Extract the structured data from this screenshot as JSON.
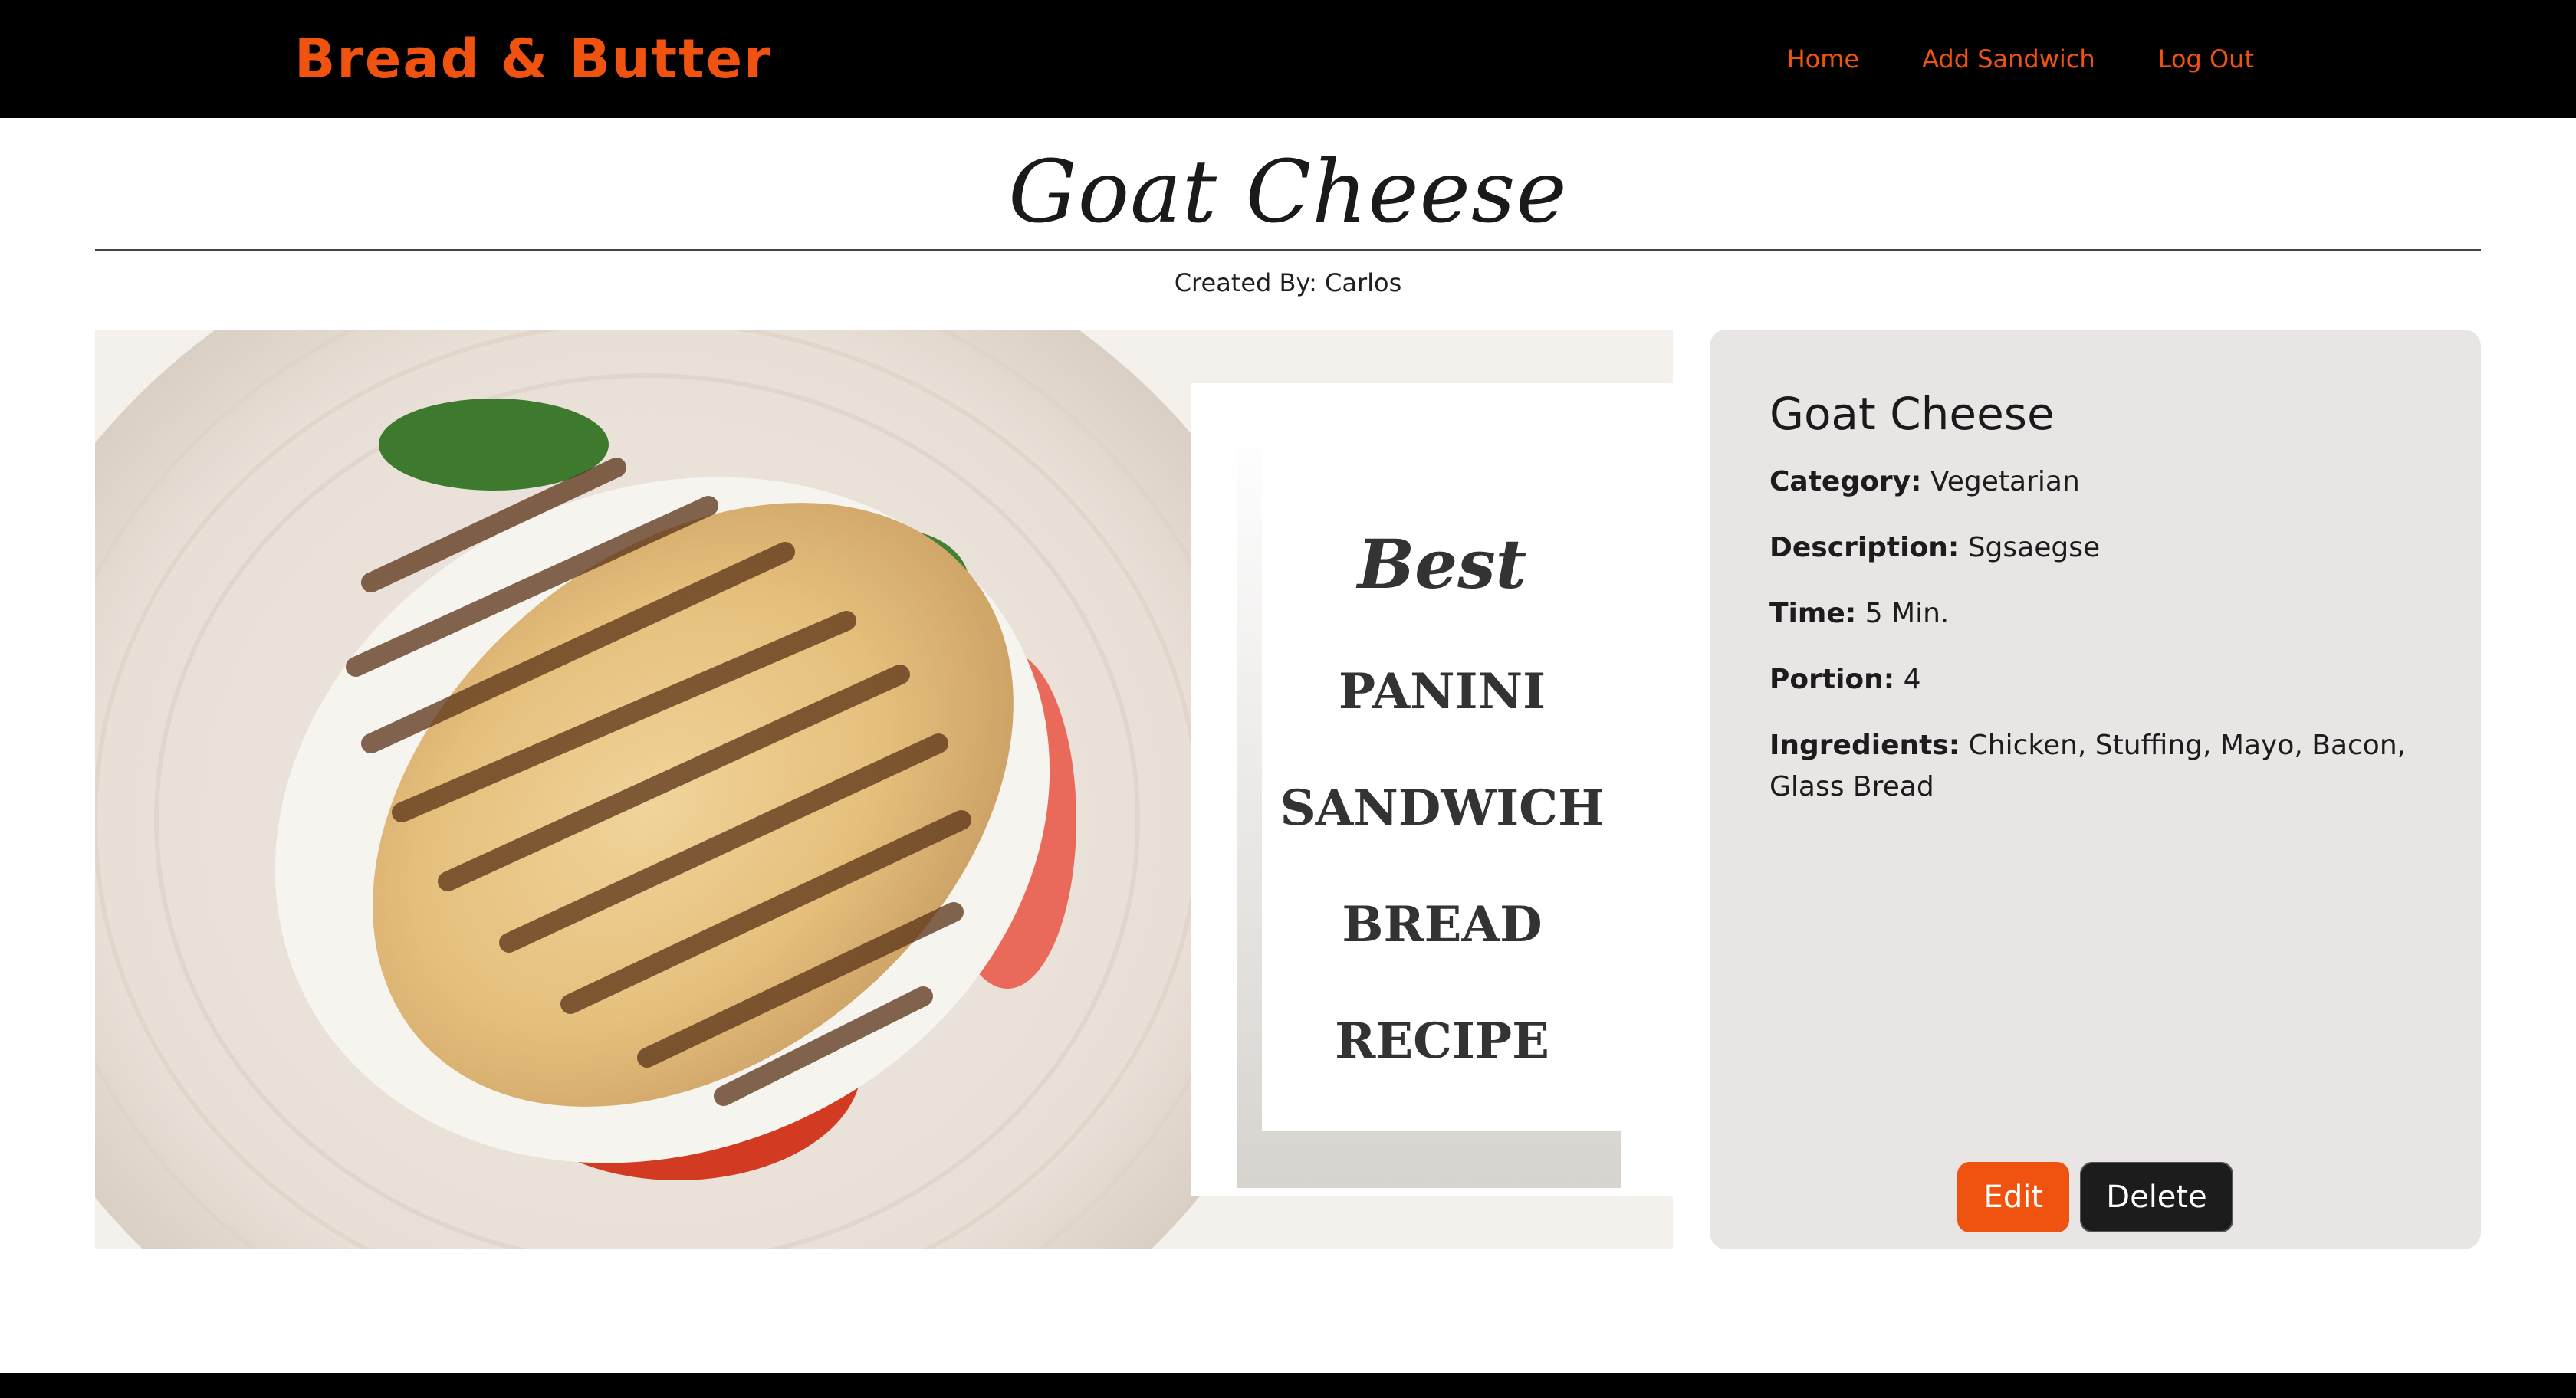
{
  "nav": {
    "brand": "Bread & Butter",
    "links": [
      "Home",
      "Add Sandwich",
      "Log Out"
    ]
  },
  "page": {
    "title": "Goat Cheese",
    "created_by": "Created By: Carlos"
  },
  "image": {
    "overlay_lines": [
      "Best",
      "PANINI",
      "SANDWICH",
      "BREAD",
      "RECIPE"
    ]
  },
  "details": {
    "name": "Goat Cheese",
    "fields": [
      {
        "label": "Category:",
        "value": "Vegetarian"
      },
      {
        "label": "Description:",
        "value": "Sgsaegse"
      },
      {
        "label": "Time:",
        "value": "5 Min."
      },
      {
        "label": "Portion:",
        "value": "4"
      },
      {
        "label": "Ingredients:",
        "value": "Chicken, Stuffing, Mayo, Bacon, Glass Bread"
      }
    ]
  },
  "actions": {
    "edit": "Edit",
    "delete": "Delete"
  },
  "colors": {
    "accent": "#f0520f",
    "navbar_bg": "#000000",
    "card_bg": "#eae5e5",
    "delete_bg": "#1c1c1c"
  }
}
